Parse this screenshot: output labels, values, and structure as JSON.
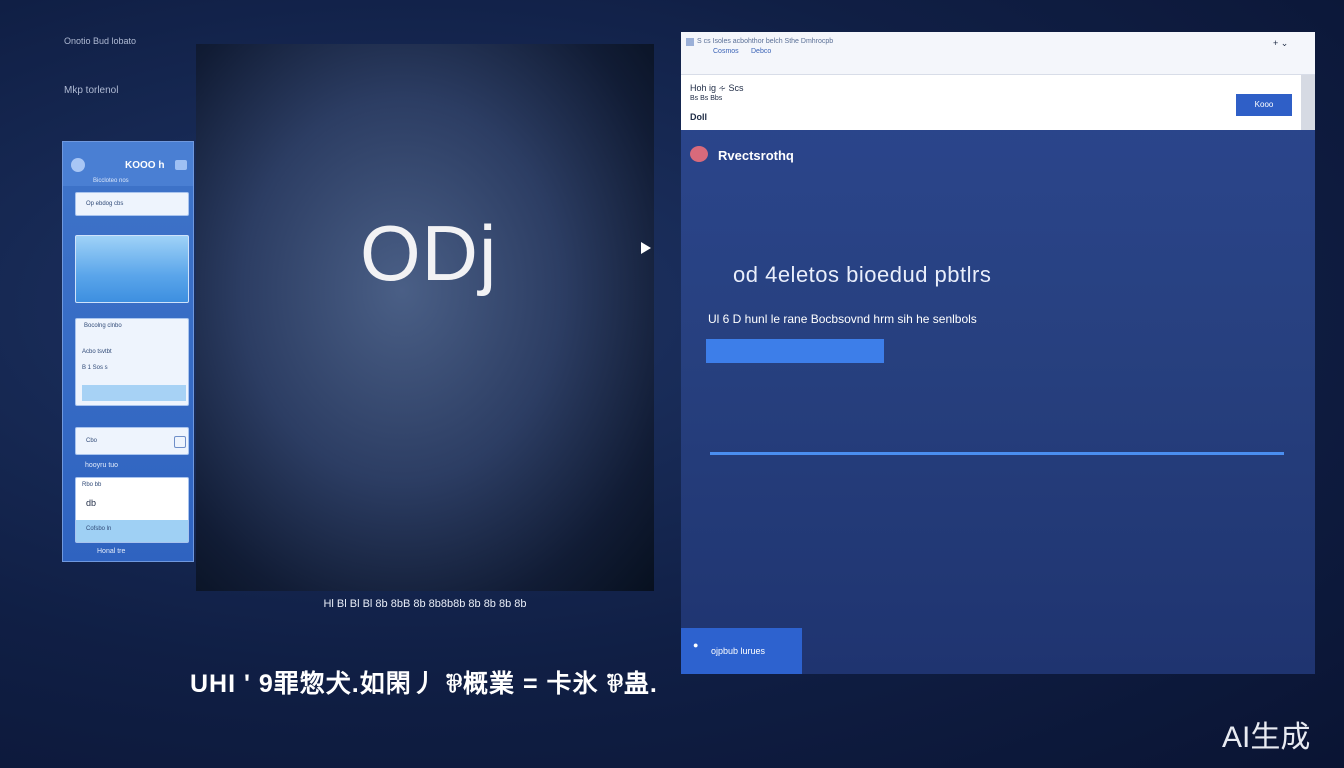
{
  "desktop": {
    "label_top": "Onotio Bud lobato",
    "label_second": "Mkp torlenol"
  },
  "phone": {
    "title": "KOOO h",
    "subtitle": "Biccloteo nos",
    "card1_text": "Op ebdog cbs",
    "card3_title": "Bocolng clnbo",
    "card3_line1": "Acbo tsvtbt",
    "card3_line2": "B 1 Sos s",
    "card4_text": "Cbo",
    "link": "hooyru tuo",
    "card5_line1": "Rbo bb",
    "card5_line2": "db",
    "card5_line3": "Cofsbo ln",
    "footer_link": "Honal tre"
  },
  "video": {
    "title": "ODj",
    "caption": "Hl Bl Bl  Bl 8b 8bB  8b 8b8b8b 8b  8b 8b 8b",
    "bottom_caption": "UHI ' 9罪惣犬.如閑丿 ⅌概業 = 卡氷 ⅌蛊."
  },
  "window": {
    "tab_text": "S cs Isoles acbohthor   belch Sthe   Dmhrocpb",
    "tab_sub1": "Cosmos",
    "tab_sub2": "Debco",
    "tab_right": "+ ⌄",
    "header_line1": "Hoh ig   ∻ Scs",
    "header_line2": "Bs Bs Bbs",
    "header_line3": "Doll",
    "header_button": "Kooo",
    "section_title": "Rvectsrothq",
    "main_heading": "od 4eletos bioedud  pbtlrs",
    "main_desc": "Ul 6 D hunl le rane Bocbsovnd hrm sih he senlbols",
    "footer_button": "ojpbub lurues",
    "footer_icon": "●"
  },
  "watermark": "AI生成",
  "colors": {
    "background": "#101f45",
    "window": "#27407f",
    "accent": "#3d7ee9",
    "header_button": "#2f5fc7"
  }
}
